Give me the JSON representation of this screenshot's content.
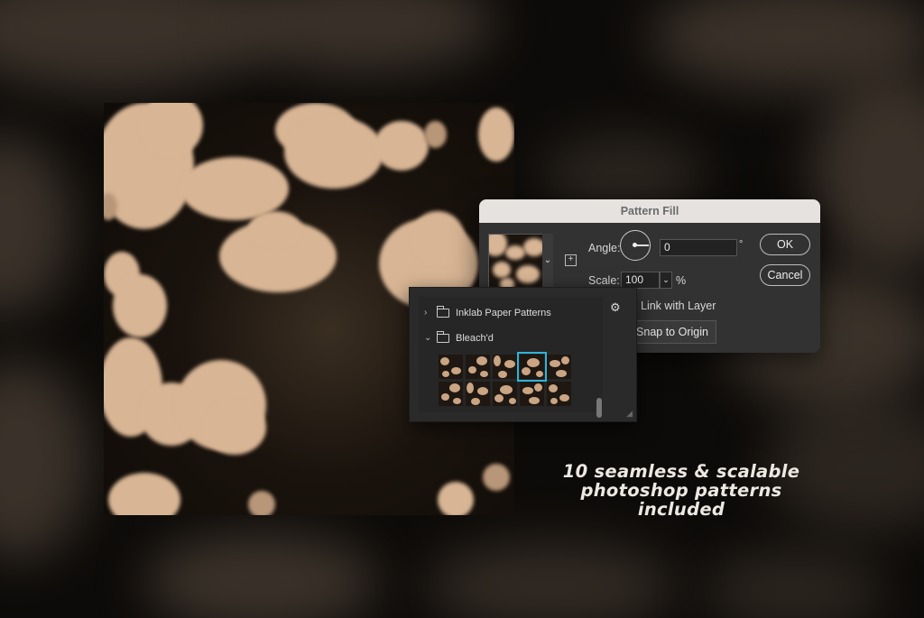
{
  "dialog": {
    "title": "Pattern Fill",
    "angle_label": "Angle:",
    "angle_value": "0",
    "angle_unit": "°",
    "scale_label": "Scale:",
    "scale_value": "100",
    "scale_unit": "%",
    "ok_label": "OK",
    "cancel_label": "Cancel",
    "link_label": "Link with Layer",
    "snap_label": "Snap to Origin",
    "dropdown_chevron": "⌄",
    "new_preset_glyph": "+"
  },
  "picker": {
    "folders": [
      {
        "label": "Inklab Paper Patterns",
        "chevron": "›"
      },
      {
        "label": "Bleach'd",
        "chevron": "⌄"
      }
    ],
    "gear_glyph": "⚙",
    "selected_index": 3,
    "resize_glyph": "◢"
  },
  "caption": {
    "line1": "10 seamless & scalable",
    "line2": "photoshop patterns",
    "line3": "included"
  },
  "colors": {
    "accent_selection": "#2fb4d8",
    "pattern_light": "#d8b594",
    "pattern_dark": "#1a130d"
  },
  "icons": [
    "folder-icon",
    "gear-icon",
    "chevron-right-icon",
    "chevron-down-icon",
    "angle-dial-icon",
    "new-preset-icon",
    "resize-grip-icon"
  ]
}
